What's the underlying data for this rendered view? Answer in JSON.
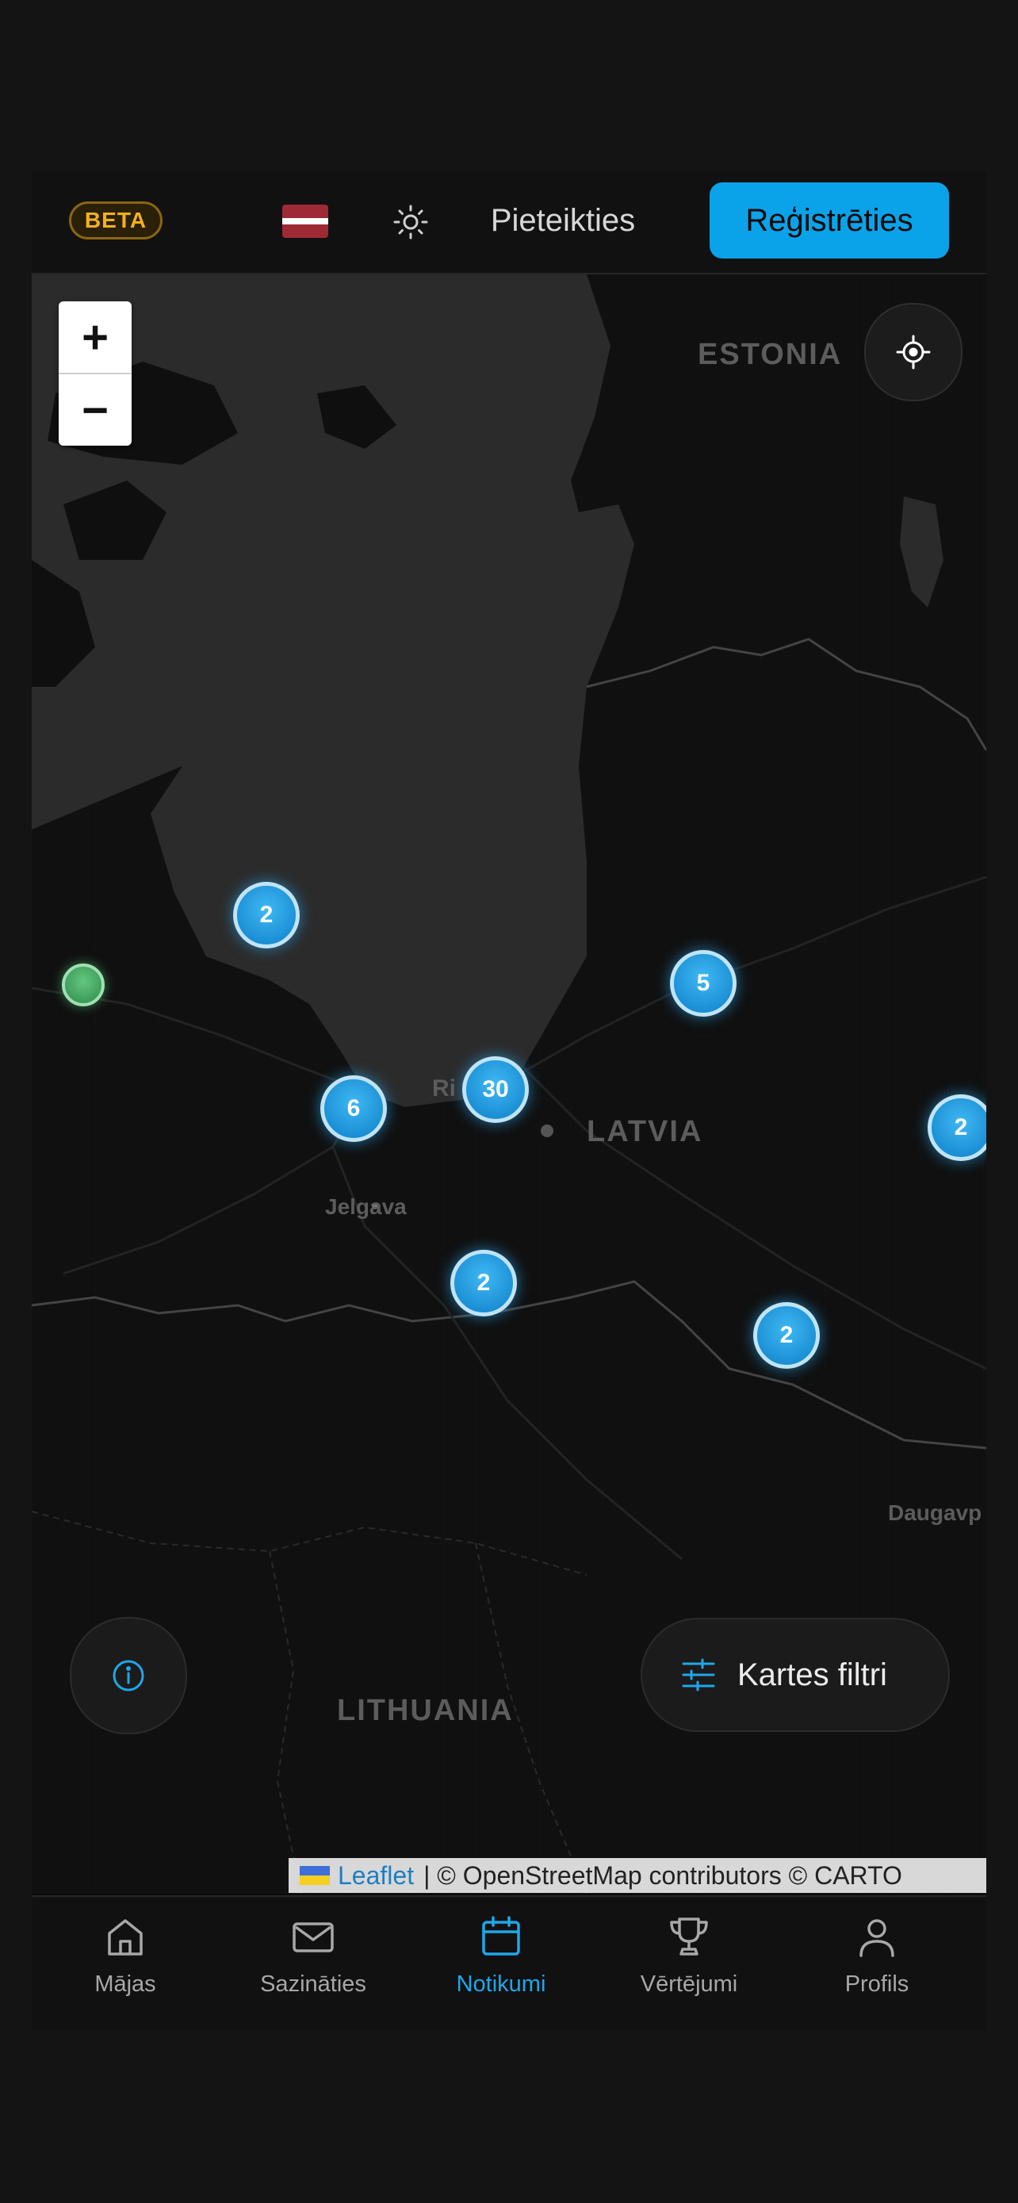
{
  "header": {
    "beta_label": "BETA",
    "flag_icon": "latvia-flag-icon",
    "theme_icon": "sun-icon",
    "login_label": "Pieteikties",
    "register_label": "Reģistrēties",
    "accent_color": "#0aa3ea"
  },
  "map": {
    "zoom_in_label": "+",
    "zoom_out_label": "−",
    "locate_icon": "crosshair-icon",
    "place_labels": {
      "estonia": "ESTONIA",
      "latvia": "LATVIA",
      "lithuania": "LITHUANIA",
      "jelgava": "Jelgava",
      "riga_partial": "Ri",
      "daugavpils_partial": "Daugavp"
    },
    "clusters": [
      "2",
      "5",
      "6",
      "30",
      "2",
      "2",
      "2"
    ],
    "single_marker_color": "#4caf6a",
    "info_icon": "info-icon",
    "filters_icon": "sliders-icon",
    "filters_label": "Kartes filtri",
    "attribution": {
      "leaflet": "Leaflet",
      "rest": "| © OpenStreetMap contributors © CARTO"
    }
  },
  "bottom_nav": {
    "items": [
      {
        "label": "Mājas",
        "icon": "home-icon"
      },
      {
        "label": "Sazināties",
        "icon": "mail-icon"
      },
      {
        "label": "Notikumi",
        "icon": "calendar-icon"
      },
      {
        "label": "Vērtējumi",
        "icon": "trophy-icon"
      },
      {
        "label": "Profils",
        "icon": "user-icon"
      }
    ],
    "active_index": 2,
    "active_color": "#1fa7ea"
  }
}
